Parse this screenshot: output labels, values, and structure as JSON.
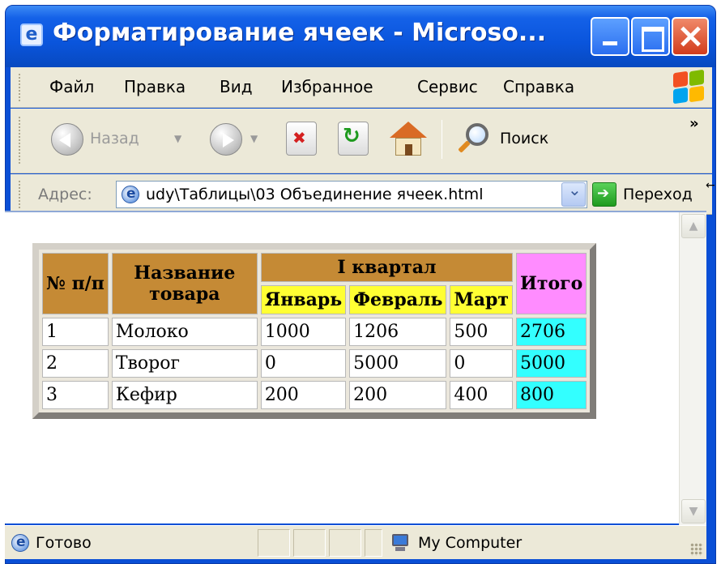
{
  "window": {
    "title": "Форматирование ячеек - Microso..."
  },
  "menu": {
    "items": [
      {
        "label": "Файл"
      },
      {
        "label": "Правка"
      },
      {
        "label": "Вид"
      },
      {
        "label": "Избранное"
      },
      {
        "label": "Сервис"
      },
      {
        "label": "Справка"
      }
    ]
  },
  "toolbar": {
    "back_label": "Назад",
    "search_label": "Поиск",
    "more": "»"
  },
  "address": {
    "label": "Адрес:",
    "value": "udy\\Таблицы\\03 Объединение ячеек.html",
    "go_label": "Переход"
  },
  "table": {
    "headers": {
      "num": "№ п/п",
      "name": "Название товара",
      "quarter": "I квартал",
      "total": "Итого",
      "months": [
        "Январь",
        "Февраль",
        "Март"
      ]
    },
    "rows": [
      {
        "num": "1",
        "name": "Молоко",
        "jan": "1000",
        "feb": "1206",
        "mar": "500",
        "total": "2706"
      },
      {
        "num": "2",
        "name": "Творог",
        "jan": "0",
        "feb": "5000",
        "mar": "0",
        "total": "5000"
      },
      {
        "num": "3",
        "name": "Кефир",
        "jan": "200",
        "feb": "200",
        "mar": "400",
        "total": "800"
      }
    ],
    "colors": {
      "header_brown": "#c58a35",
      "header_yellow": "#ffff33",
      "header_pink": "#ff8cff",
      "total_cyan": "#33ffff"
    }
  },
  "status": {
    "text": "Готово",
    "zone": "My Computer"
  },
  "icons": {
    "title": "ie-page-icon",
    "back": "back-arrow-icon",
    "forward": "forward-arrow-icon",
    "stop": "stop-icon",
    "refresh": "refresh-icon",
    "home": "home-icon",
    "search": "search-icon",
    "go": "go-arrow-icon",
    "zone": "my-computer-icon"
  }
}
